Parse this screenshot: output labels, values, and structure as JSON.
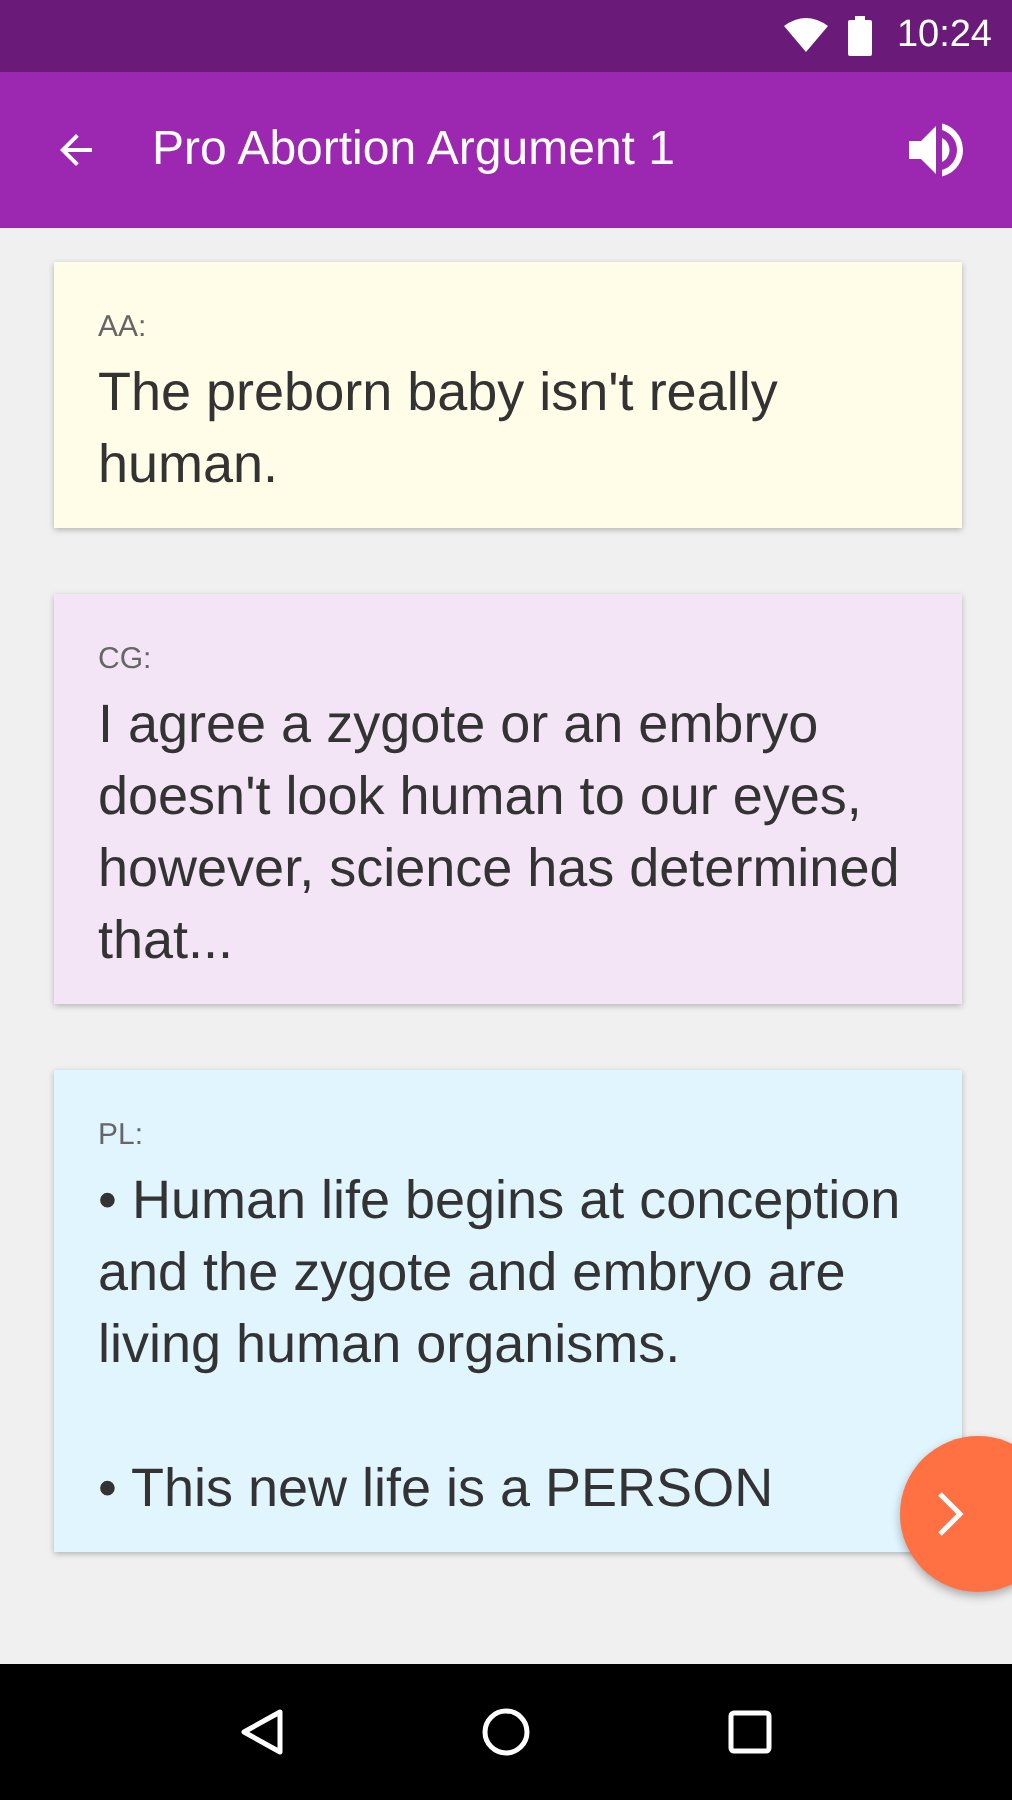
{
  "status_bar": {
    "time": "10:24"
  },
  "app_bar": {
    "title": "Pro Abortion Argument 1"
  },
  "messages": [
    {
      "speaker": "AA:",
      "paragraphs": [
        "The preborn baby isn't really human."
      ],
      "color": "#fffde7"
    },
    {
      "speaker": "CG:",
      "paragraphs": [
        "I agree a zygote or an embryo doesn't look human to our eyes, however, science has determined that..."
      ],
      "color": "#f3e5f5"
    },
    {
      "speaker": "PL:",
      "paragraphs": [
        "• Human life begins at conception and the zygote and embryo are living human organisms.",
        "• This new life is a PERSON"
      ],
      "color": "#e1f5fe"
    }
  ]
}
